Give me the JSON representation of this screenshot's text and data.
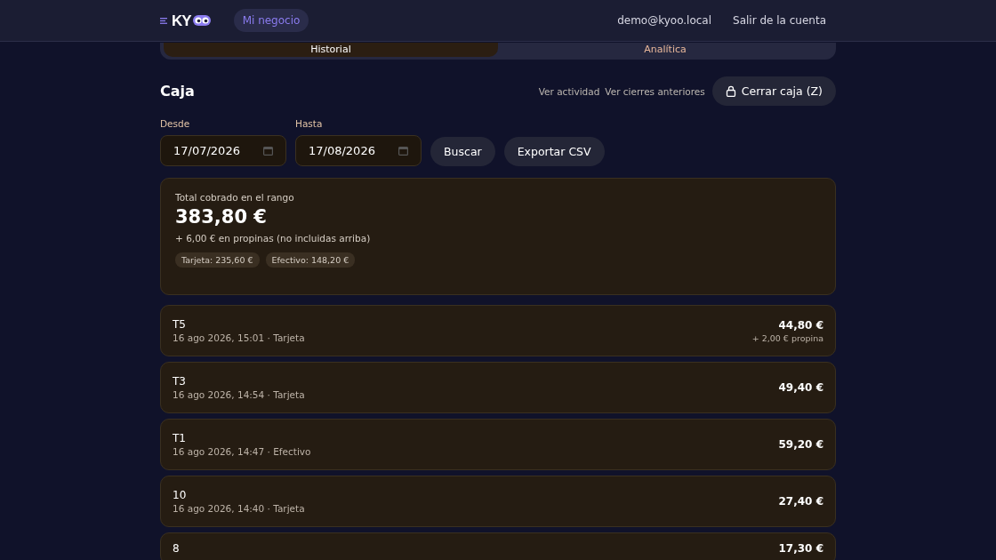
{
  "header": {
    "logo": "KY",
    "nav": [
      {
        "label": "Mi negocio",
        "selected": true
      }
    ],
    "email": "demo@kyoo.local",
    "logout": "Salir de la cuenta"
  },
  "tabs": [
    {
      "label": "Historial",
      "selected": true
    },
    {
      "label": "Analítica",
      "selected": false
    }
  ],
  "title": "Caja",
  "actions": {
    "links": [
      "Ver actividad",
      "Ver cierres anteriores"
    ],
    "close_button": "Cerrar caja (Z)"
  },
  "filters": {
    "from": {
      "label": "Desde",
      "value": "17/07/2026"
    },
    "to": {
      "label": "Hasta",
      "value": "17/08/2026"
    },
    "buttons": [
      "Buscar",
      "Exportar CSV"
    ]
  },
  "summary": {
    "label": "Total cobrado en el rango",
    "total": "383,80 €",
    "tips": "+ 6,00 € en propinas (no incluidas arriba)",
    "chips": [
      "Tarjeta: 235,60 €",
      "Efectivo: 148,20 €"
    ]
  },
  "rows": [
    {
      "name": "T5",
      "meta": "16 ago 2026, 15:01 · Tarjeta",
      "amount": "44,80 €",
      "tip": "+ 2,00 € propina"
    },
    {
      "name": "T3",
      "meta": "16 ago 2026, 14:54 · Tarjeta",
      "amount": "49,40 €"
    },
    {
      "name": "T1",
      "meta": "16 ago 2026, 14:47 · Efectivo",
      "amount": "59,20 €"
    },
    {
      "name": "10",
      "meta": "16 ago 2026, 14:40 · Tarjeta",
      "amount": "27,40 €"
    },
    {
      "name": "8",
      "amount": "17,30 €"
    }
  ]
}
